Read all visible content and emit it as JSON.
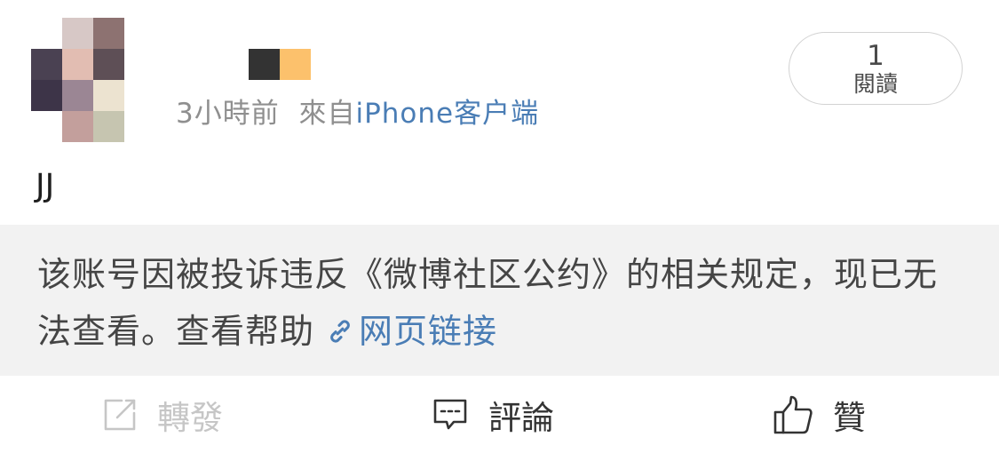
{
  "post": {
    "time": "3小時前",
    "source_prefix": "來自",
    "source": "iPhone客户端",
    "text": "JJ"
  },
  "read_count": {
    "value": "1",
    "label": "閱讀"
  },
  "notice": {
    "message": "该账号因被投诉违反《微博社区公约》的相关规定，现已无法查看。",
    "help_link": "查看帮助",
    "web_link": "网页链接"
  },
  "actions": {
    "repost_label": "轉發",
    "comment_label": "評論",
    "like_label": "贊"
  },
  "colors": {
    "link": "#4a7db5",
    "muted": "#8f8f8f",
    "notice_bg": "#f2f2f2",
    "disabled": "#c6c6c6"
  },
  "icons": {
    "repost": "repost-icon",
    "comment": "comment-icon",
    "like": "thumbs-up-icon",
    "link": "link-icon"
  }
}
